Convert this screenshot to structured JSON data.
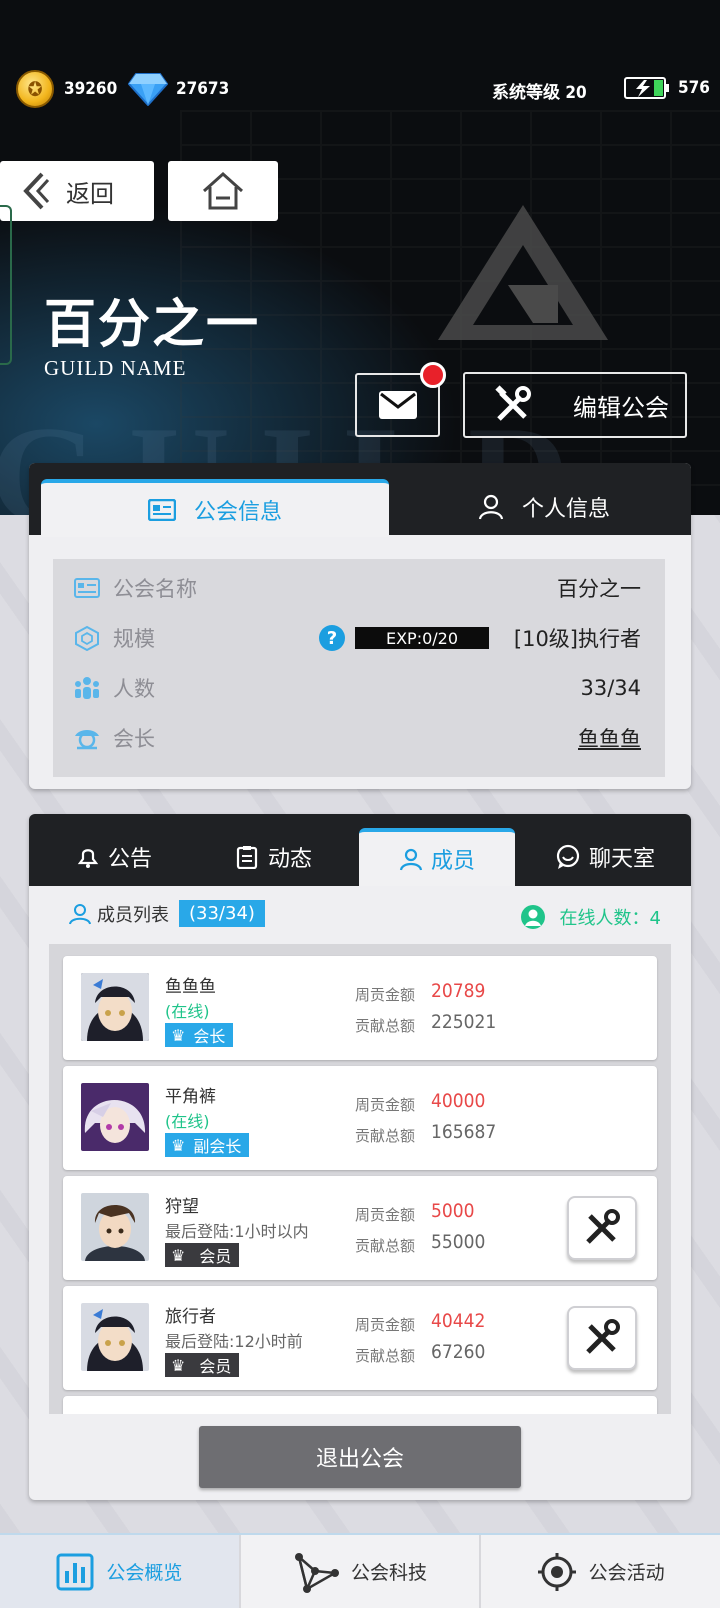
{
  "resources": {
    "gold": "39260",
    "diamond": "27673",
    "system_level": "系统等级 20",
    "energy": "576"
  },
  "nav": {
    "back_label": "返回"
  },
  "guild": {
    "title": "百分之一",
    "subtitle": "GUILD NAME",
    "edit_label": "编辑公会"
  },
  "info_tabs": {
    "guild_info": "公会信息",
    "personal_info": "个人信息"
  },
  "info": {
    "name_label": "公会名称",
    "name_value": "百分之一",
    "scale_label": "规模",
    "exp": "EXP:0/20",
    "scale_value": "[10级]执行者",
    "members_label": "人数",
    "members_value": "33/34",
    "leader_label": "会长",
    "leader_value": "鱼鱼鱼"
  },
  "member_tabs": {
    "notice": "公告",
    "activity": "动态",
    "members": "成员",
    "chat": "聊天室"
  },
  "member_list": {
    "header": "成员列表",
    "count": "(33/34)",
    "online": "在线人数：4",
    "weekly_label": "周贡金额",
    "total_label": "贡献总额",
    "rows": [
      {
        "name": "鱼鱼鱼",
        "status": "(在线)",
        "role": "会长",
        "weekly": "20789",
        "total": "225021"
      },
      {
        "name": "平角裤",
        "status": "(在线)",
        "role": "副会长",
        "weekly": "40000",
        "total": "165687"
      },
      {
        "name": "狩望",
        "status": "最后登陆:1小时以内",
        "role": "会员",
        "weekly": "5000",
        "total": "55000"
      },
      {
        "name": "旅行者",
        "status": "最后登陆:12小时前",
        "role": "会员",
        "weekly": "40442",
        "total": "67260"
      }
    ],
    "quit_label": "退出公会"
  },
  "bottom_nav": {
    "overview": "公会概览",
    "tech": "公会科技",
    "events": "公会活动"
  },
  "colors": {
    "accent": "#29a8e8",
    "online": "#1fc48a",
    "weekly_red": "#e84848",
    "dark_bar": "#1f2124"
  }
}
